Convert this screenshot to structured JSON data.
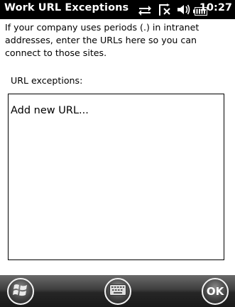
{
  "status_bar": {
    "title": "Work URL Exceptions",
    "time": "10:27",
    "icons": [
      "connectivity-icon",
      "no-signal-icon",
      "volume-muted-icon",
      "battery-icon"
    ]
  },
  "main": {
    "description": "If your company uses periods (.) in intranet addresses, enter the URLs here so you can connect to those sites.",
    "list_label": "URL exceptions:",
    "add_new_url": "Add new URL..."
  },
  "menu_bar": {
    "start_icon": "windows-start-icon",
    "keyboard_icon": "keyboard-icon",
    "ok_label": "OK"
  },
  "colors": {
    "status_bar_bg": "#000000",
    "menu_bar_bg": "#2e2e2e",
    "page_bg": "#ffffff"
  }
}
